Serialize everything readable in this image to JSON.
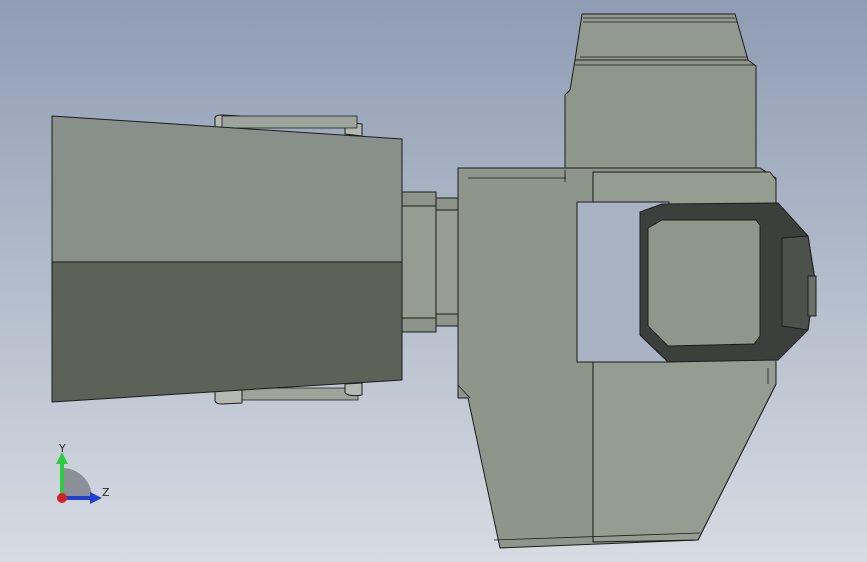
{
  "viewport": {
    "background_top": "#8f9cb3",
    "background_bottom": "#d7dbe2"
  },
  "model": {
    "body_fill": "#8e958b",
    "body_light_fill": "#959c92",
    "body_dark_fill": "#5d6258",
    "edge_color": "#1c1c1c",
    "face_dark": "#3c403c",
    "hole_fill": "#a9b3c4"
  },
  "triad": {
    "y_label": "Y",
    "z_label": "Z",
    "y_color": "#2ecc40",
    "z_color": "#1f3fd6",
    "x_color": "#d42222",
    "plane_color": "#8a8f98"
  }
}
